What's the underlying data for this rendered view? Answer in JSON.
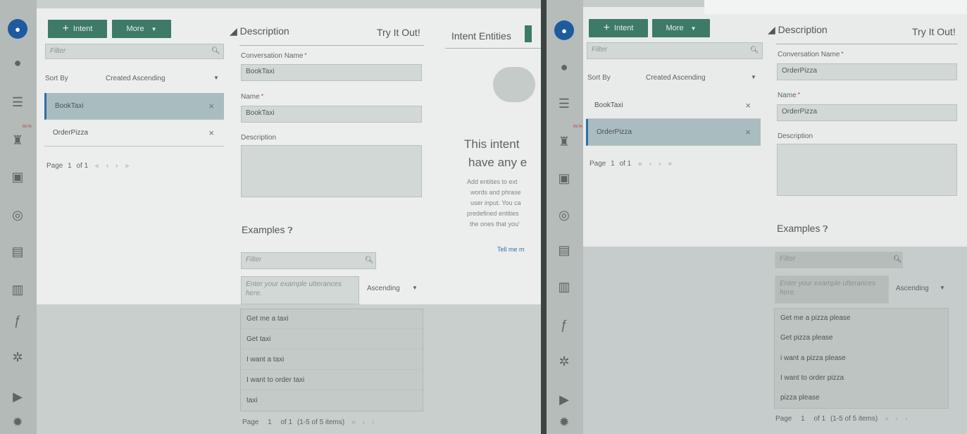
{
  "left": {
    "toolbar": {
      "intent_label": "Intent",
      "more_label": "More"
    },
    "filter_placeholder": "Filter",
    "sort": {
      "label": "Sort By",
      "value": "Created Ascending"
    },
    "intents": [
      {
        "name": "BookTaxi",
        "selected": true
      },
      {
        "name": "OrderPizza",
        "selected": false
      }
    ],
    "pager": {
      "page_label": "Page",
      "page": "1",
      "of": "of 1"
    },
    "details": {
      "description_title": "Description",
      "try_it": "Try It Out!",
      "conv_name_label": "Conversation Name",
      "conv_name_value": "BookTaxi",
      "name_label": "Name",
      "name_value": "BookTaxi",
      "desc_label": "Description",
      "examples_title": "Examples",
      "examples_filter": "Filter",
      "utterance_placeholder": "Enter your example utterances here.",
      "sort_value": "Ascending",
      "examples": [
        "Get me a taxi",
        "Get taxi",
        "I want a taxi",
        "I want to order taxi",
        "taxi"
      ],
      "pager": {
        "page_label": "Page",
        "page": "1",
        "of": "of 1",
        "items": "(1-5 of 5 items)"
      }
    },
    "entities": {
      "title": "Intent Entities",
      "empty_line1": "This intent",
      "empty_line2": "have any e",
      "help_lines": [
        "Add entities to ext",
        "words and phrase",
        "user input. You ca",
        "predefined entities",
        "the ones that you'"
      ],
      "link": "Tell me m"
    }
  },
  "right": {
    "toolbar": {
      "intent_label": "Intent",
      "more_label": "More"
    },
    "filter_placeholder": "Filter",
    "sort": {
      "label": "Sort By",
      "value": "Created Ascending"
    },
    "intents": [
      {
        "name": "BookTaxi",
        "selected": false
      },
      {
        "name": "OrderPizza",
        "selected": true
      }
    ],
    "pager": {
      "page_label": "Page",
      "page": "1",
      "of": "of 1"
    },
    "details": {
      "description_title": "Description",
      "try_it": "Try It Out!",
      "conv_name_label": "Conversation Name",
      "conv_name_value": "OrderPizza",
      "name_label": "Name",
      "name_value": "OrderPizza",
      "desc_label": "Description",
      "examples_title": "Examples",
      "examples_filter": "Filter",
      "utterance_placeholder": "Enter your example utterances here.",
      "sort_value": "Ascending",
      "examples": [
        "Get me a pizza please",
        "Get pizza please",
        "i want a pizza please",
        "I want to order pizza",
        "pizza please"
      ],
      "pager": {
        "page_label": "Page",
        "page": "1",
        "of": "of 1",
        "items": "(1-5 of 5 items)"
      }
    }
  },
  "beta_label": "BETA",
  "icons": {
    "home": "bot-icon",
    "intents": "chat-bubble-icon",
    "entities": "list-icon",
    "flows": "robot-icon",
    "translate": "translate-icon",
    "qna": "qna-icon",
    "tests": "clipboard-icon",
    "insights": "bar-chart-icon",
    "functions": "function-icon",
    "settings": "gear-icon",
    "run": "play-icon",
    "debug": "bug-icon"
  }
}
